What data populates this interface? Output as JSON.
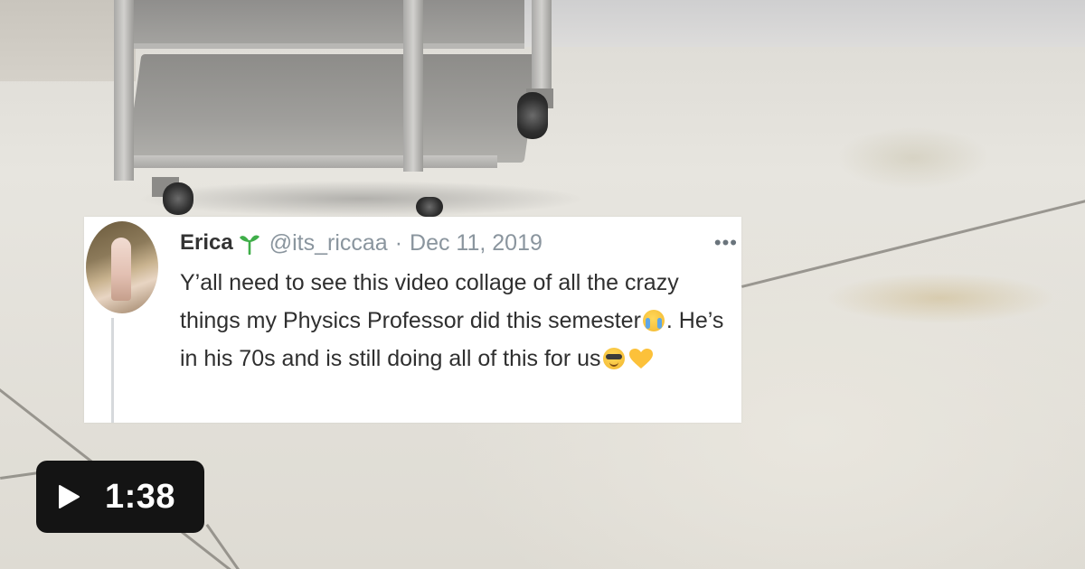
{
  "tweet": {
    "display_name": "Erica",
    "handle": "@its_riccaa",
    "separator": "·",
    "date": "Dec 11, 2019",
    "more": "•••",
    "body_part1": "Y’all need to see this video collage of all the crazy things my Physics Professor did this semester",
    "body_part2": ". He’s in his 70s and is still doing all of this for us",
    "emojis": [
      "loudly-crying-face",
      "smiling-face-with-sunglasses",
      "yellow-heart"
    ],
    "colors": {
      "name": "#333333",
      "muted": "#8a959e",
      "sprout": "#3fae49",
      "heart": "#fcc13a"
    }
  },
  "video": {
    "duration": "1:38",
    "play_icon": "play-icon"
  }
}
